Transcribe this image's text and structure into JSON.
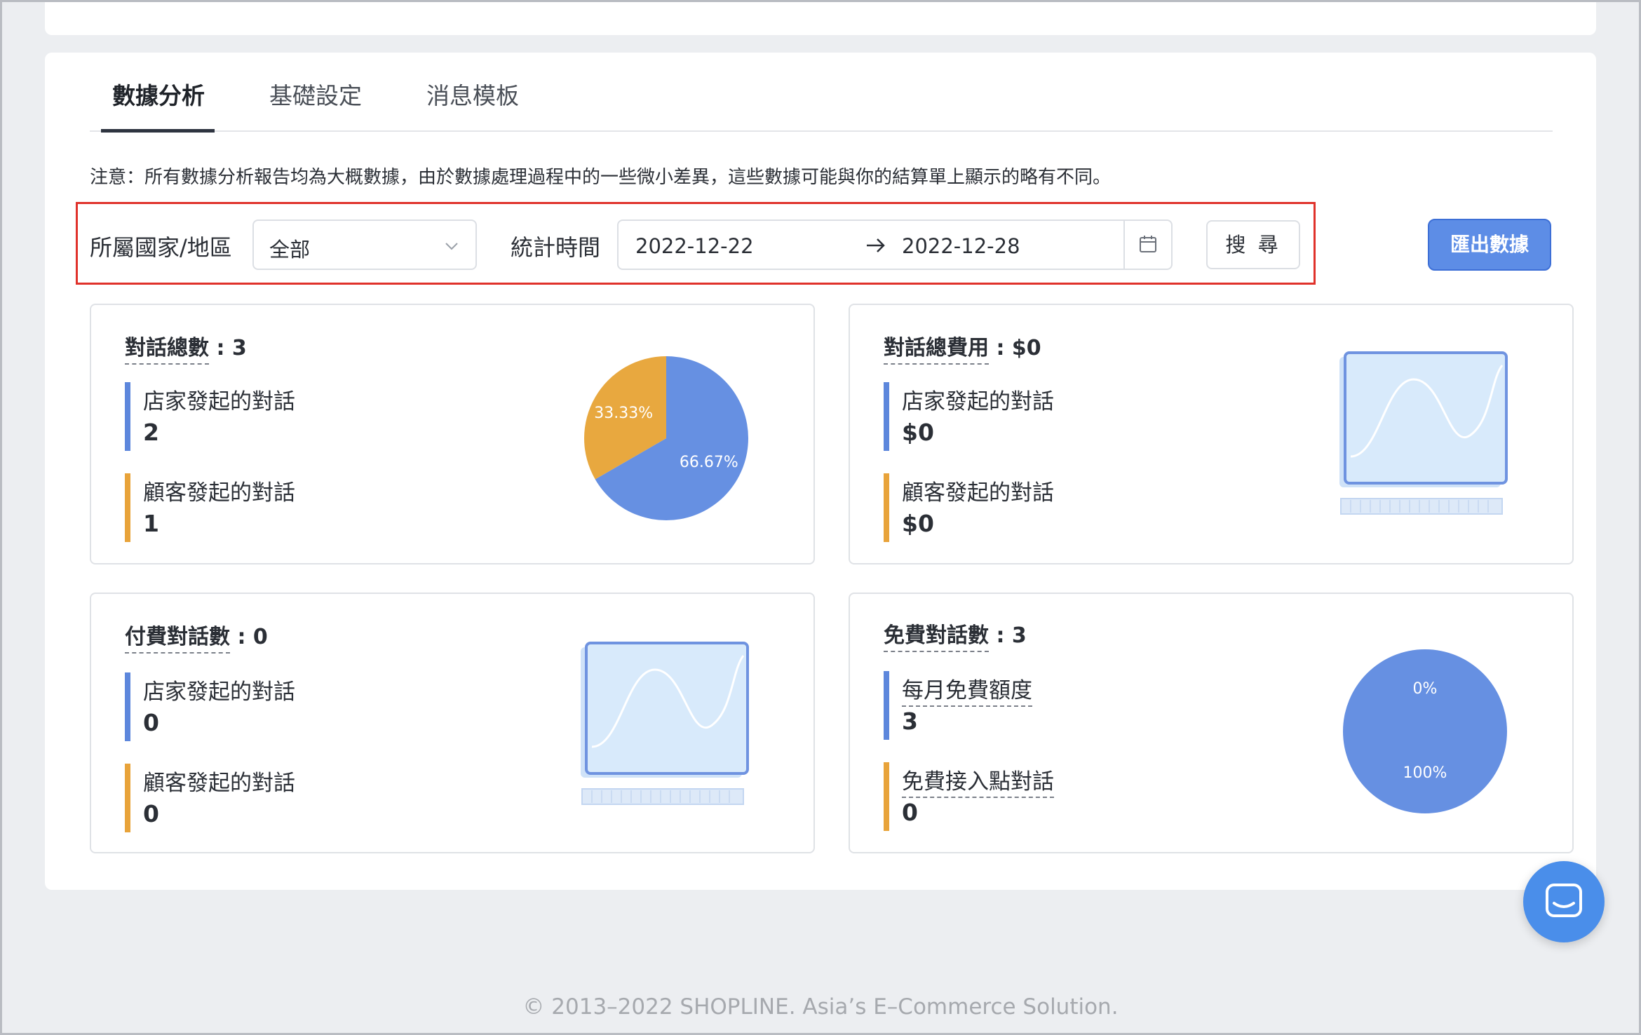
{
  "tabs": [
    {
      "label": "數據分析",
      "active": true
    },
    {
      "label": "基礎設定",
      "active": false
    },
    {
      "label": "消息模板",
      "active": false
    }
  ],
  "notice": "注意：所有數據分析報告均為大概數據，由於數據處理過程中的一些微小差異，這些數據可能與你的結算單上顯示的略有不同。",
  "filters": {
    "region_label": "所屬國家/地區",
    "region_value": "全部",
    "period_label": "統計時間",
    "date_from": "2022-12-22",
    "date_to": "2022-12-28",
    "search_label": "搜 尋",
    "export_label": "匯出數據"
  },
  "cards": {
    "total_conversations": {
      "title": "對話總數",
      "value": ": 3",
      "metrics": [
        {
          "label": "店家發起的對話",
          "value": "2"
        },
        {
          "label": "顧客發起的對話",
          "value": "1"
        }
      ]
    },
    "total_cost": {
      "title": "對話總費用",
      "value": ": $0",
      "metrics": [
        {
          "label": "店家發起的對話",
          "value": "$0"
        },
        {
          "label": "顧客發起的對話",
          "value": "$0"
        }
      ]
    },
    "paid_conversations": {
      "title": "付費對話數",
      "value": ": 0",
      "metrics": [
        {
          "label": "店家發起的對話",
          "value": "0"
        },
        {
          "label": "顧客發起的對話",
          "value": "0"
        }
      ]
    },
    "free_conversations": {
      "title": "免費對話數",
      "value": ": 3",
      "metrics": [
        {
          "label": "每月免費額度",
          "value": "3"
        },
        {
          "label": "免費接入點對話",
          "value": "0"
        }
      ]
    }
  },
  "chart_data": [
    {
      "type": "pie",
      "categories": [
        "店家發起的對話",
        "顧客發起的對話"
      ],
      "values": [
        66.67,
        33.33
      ],
      "labels": [
        "66.67%",
        "33.33%"
      ],
      "colors": [
        "#6690e2",
        "#e8a83f"
      ]
    },
    {
      "type": "pie",
      "categories": [
        "每月免費額度",
        "免費接入點對話"
      ],
      "values": [
        100,
        0
      ],
      "labels": [
        "100%",
        "0%"
      ],
      "colors": [
        "#6690e2",
        "#e8a83f"
      ]
    }
  ],
  "colors": {
    "accent": "#5d8de6",
    "merchant": "#5d87dc",
    "customer": "#e8a33a",
    "highlight_box": "#e0322b"
  },
  "footer": "© 2013–2022 SHOPLINE. Asia’s E–Commerce Solution."
}
